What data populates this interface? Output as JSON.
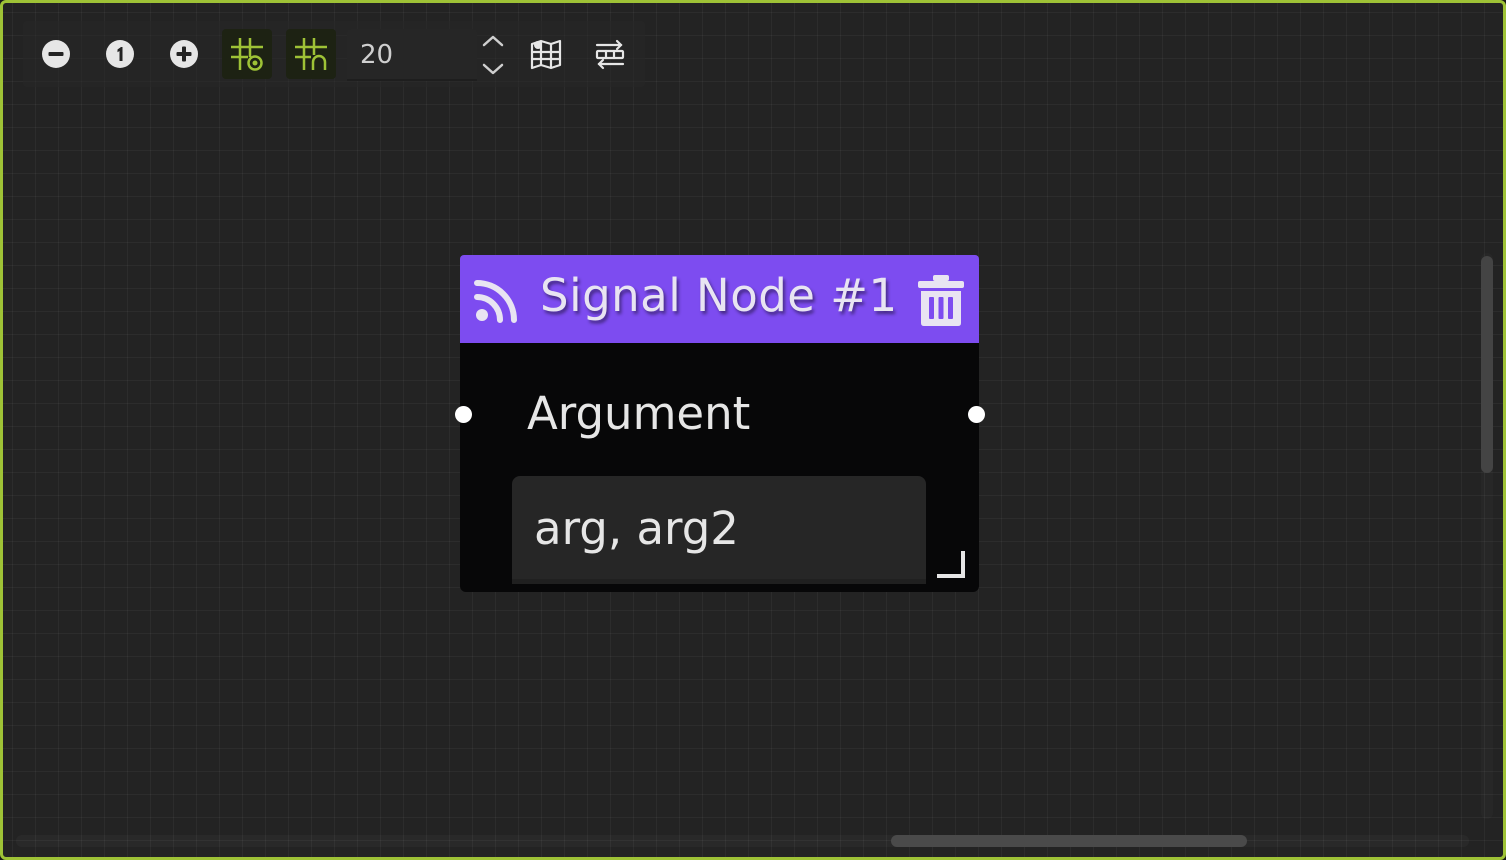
{
  "toolbar": {
    "zoom_out_icon": "minus-circle-icon",
    "zoom_reset_icon": "one-circle-icon",
    "zoom_in_icon": "plus-circle-icon",
    "snap_grid_icon": "grid-snap-icon",
    "show_grid_icon": "grid-toggle-icon",
    "snap_distance": "20",
    "minimap_icon": "minimap-icon",
    "arrange_icon": "arrange-nodes-icon",
    "active_color": "#9ec236"
  },
  "node": {
    "title": "Signal Node #1",
    "header_color": "#7d4cf0",
    "header_icon": "rss-icon",
    "delete_icon": "trash-icon",
    "argument_label": "Argument",
    "argument_value": "arg, arg2"
  },
  "colors": {
    "frame_border": "#9ec236",
    "canvas_bg": "#232323",
    "node_body": "#070708"
  }
}
